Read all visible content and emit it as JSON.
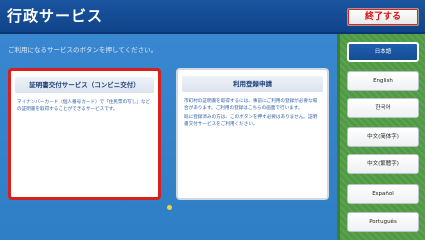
{
  "header": {
    "title": "行政サービス",
    "exit_label": "終了する"
  },
  "main": {
    "instruction": "ご利用になるサービスのボタンを押してください。",
    "cards": [
      {
        "title": "証明書交付サービス（コンビニ交付）",
        "description": "マイナンバーカード（個人番号カード）で「住民票の写し」などの証明書を取得することができるサービスです。"
      },
      {
        "title": "利用登録申請",
        "description_1": "市町村の証明書を取得するには、事前にご利用の登録が必要な場合があります。ご利用の登録はこちらの画面で行います。",
        "description_2": "既に登録済みの方は、このボタンを押す必要はありません。証明書交付サービスをご利用ください。"
      }
    ]
  },
  "languages": [
    "日本語",
    "English",
    "한국어",
    "中文(简体字)",
    "中文(繁體字)",
    "Español",
    "Português"
  ],
  "colors": {
    "header_bg": "#0f4488",
    "main_bg": "#2f7fc6",
    "language_panel_bg": "#4f9a43",
    "selected_border": "#d9201c",
    "exit_text": "#dd1111",
    "page_indicator": "#f2d23b"
  }
}
